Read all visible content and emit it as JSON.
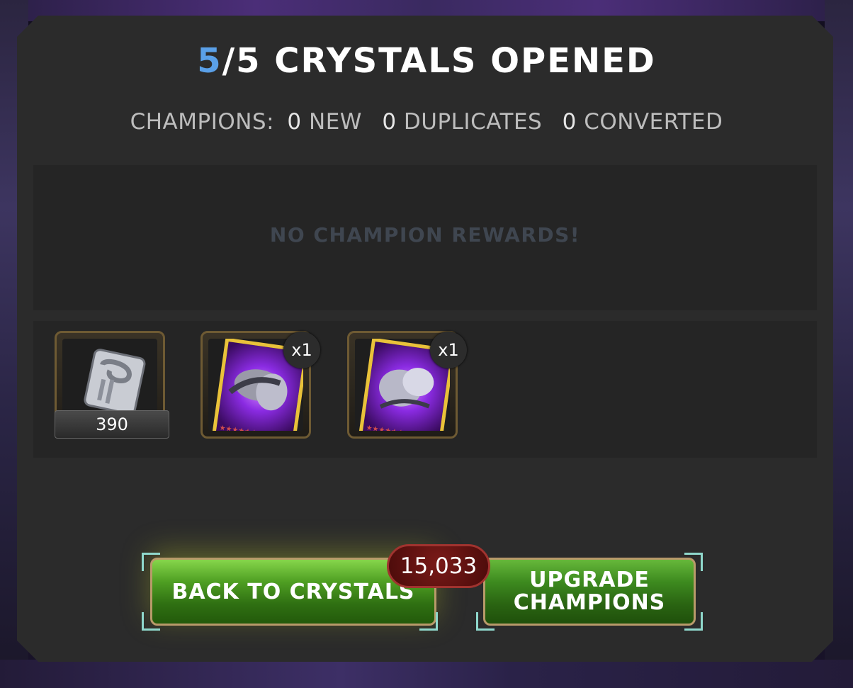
{
  "title": {
    "opened": "5",
    "rest": "/5 CRYSTALS OPENED"
  },
  "summary": {
    "label": "CHAMPIONS:",
    "new_count": "0",
    "new_label": "NEW",
    "dup_count": "0",
    "dup_label": "DUPLICATES",
    "conv_count": "0",
    "conv_label": "CONVERTED"
  },
  "no_rewards_text": "NO CHAMPION REWARDS!",
  "rewards": [
    {
      "icon": "gold-coin-card-icon",
      "quantity": "390"
    },
    {
      "icon": "champion-shard-card-icon",
      "badge": "x1"
    },
    {
      "icon": "champion-shard-card-icon",
      "badge": "x1"
    }
  ],
  "buttons": {
    "back": "BACK TO CRYSTALS",
    "upgrade_line1": "UPGRADE",
    "upgrade_line2": "CHAMPIONS"
  },
  "cost": "15,033",
  "colors": {
    "accent_blue": "#5aa0e8",
    "button_green": "#3d8a1f",
    "cost_red": "#6a1413"
  }
}
